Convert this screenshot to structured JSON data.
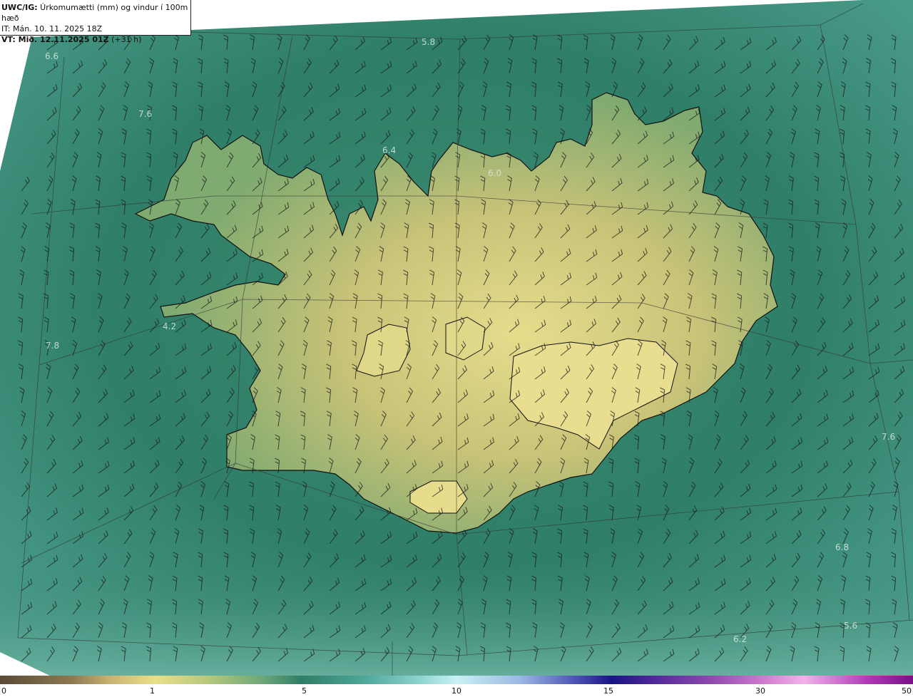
{
  "header": {
    "title_bold": "UWC/IG:",
    "title_rest": " Úrkomumætti (mm) og vindur í 100m hæð",
    "it_line": "IT: Mán. 10. 11. 2025 18Z",
    "vt_bold": "VT: Mið. 12.11.2025 01Z",
    "vt_rest": " (+31 h)"
  },
  "map_labels": [
    "5.8",
    "6.6",
    "7.6",
    "6.4",
    "6.0",
    "4.2",
    "7.8",
    "7.6",
    "6.8",
    "5.6",
    "6.2"
  ],
  "colorbar": {
    "ticks": [
      "0",
      "1",
      "5",
      "10",
      "15",
      "30",
      "50"
    ]
  },
  "colors": {
    "sea": "#3f8f7c",
    "land_low": "#b7b66e",
    "land_high": "#e3dc8a",
    "coast": "#111111"
  }
}
